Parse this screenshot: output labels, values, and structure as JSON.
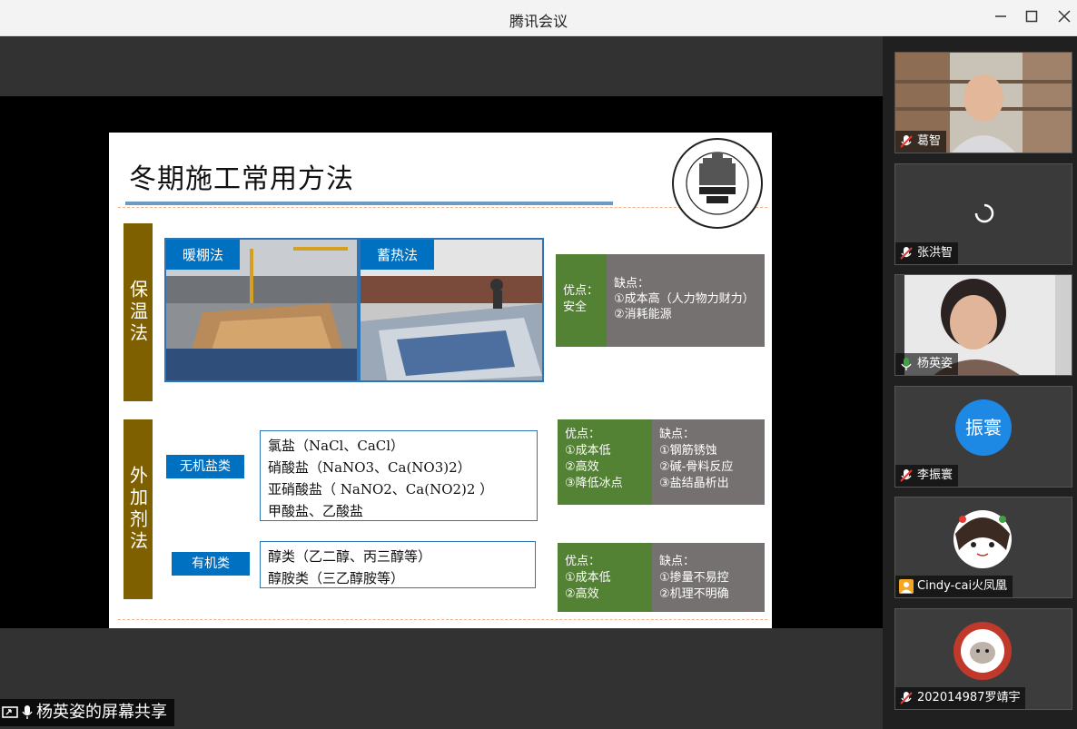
{
  "window": {
    "title": "腾讯会议"
  },
  "slide": {
    "title": "冬期施工常用方法",
    "section1_label": "保温法",
    "section2_label": "外加剂法",
    "photo1_tag": "暖棚法",
    "photo2_tag": "蓄热法",
    "box1_pro_title": "优点：",
    "box1_pro_lines": [
      "安全"
    ],
    "box1_con_title": "缺点：",
    "box1_con_lines": [
      "①成本高（人力物力财力）",
      "②消耗能源"
    ],
    "inorganic_label": "无机盐类",
    "inorganic_items": [
      "氯盐（NaCl、CaCl）",
      "硝酸盐（NaNO3、Ca(NO3)2）",
      "亚硝酸盐（ NaNO2、Ca(NO2)2 ）",
      "甲酸盐、乙酸盐"
    ],
    "box2_pro_title": "优点：",
    "box2_pro_lines": [
      "①成本低",
      "②高效",
      "③降低冰点"
    ],
    "box2_con_title": "缺点：",
    "box2_con_lines": [
      "①钢筋锈蚀",
      "②碱-骨料反应",
      "③盐结晶析出"
    ],
    "organic_label": "有机类",
    "organic_items": [
      "醇类（乙二醇、丙三醇等）",
      "醇胺类（三乙醇胺等）"
    ],
    "box3_pro_title": "优点：",
    "box3_pro_lines": [
      "①成本低",
      "②高效"
    ],
    "box3_con_title": "缺点：",
    "box3_con_lines": [
      "①掺量不易控",
      "②机理不明确"
    ]
  },
  "participants": [
    {
      "name": "葛智",
      "mic": "muted",
      "video": true
    },
    {
      "name": "张洪智",
      "mic": "muted",
      "video": false,
      "loading": true
    },
    {
      "name": "杨英姿",
      "mic": "active",
      "video": true
    },
    {
      "name": "李振寰",
      "mic": "muted",
      "avatar_text": "振寰",
      "avatar_color": "#1e88e5"
    },
    {
      "name": "Cindy-cai火凤凰",
      "mic": "muted",
      "avatar": "cartoon"
    },
    {
      "name": "202014987罗靖宇",
      "mic": "muted",
      "avatar": "university-logo"
    }
  ],
  "share_status": "杨英姿的屏幕共享",
  "colors": {
    "brown": "#7f6000",
    "green": "#548235",
    "gray": "#767171",
    "blue": "#0070c0"
  }
}
